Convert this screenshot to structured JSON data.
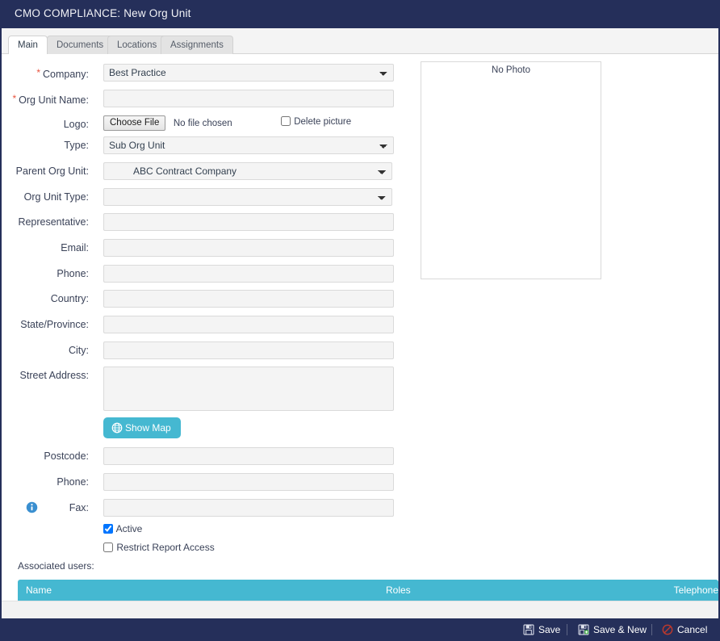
{
  "window": {
    "title_prefix": "CMO COMPLIANCE:",
    "title": "CMO COMPLIANCE: New Org Unit"
  },
  "colors": {
    "header_navy": "#252f5a",
    "accent_teal": "#45b8d1",
    "required_star": "#e8543f",
    "field_bg": "#f4f4f4"
  },
  "tabs": [
    {
      "label": "Main",
      "active": true
    },
    {
      "label": "Documents",
      "active": false
    },
    {
      "label": "Locations",
      "active": false
    },
    {
      "label": "Assignments",
      "active": false
    }
  ],
  "form": {
    "company": {
      "label": "Company:",
      "required": true,
      "value": "Best Practice"
    },
    "org_unit_name": {
      "label": "Org Unit Name:",
      "required": true,
      "value": ""
    },
    "logo": {
      "label": "Logo:",
      "button": "Choose File",
      "status": "No file chosen",
      "delete_picture_label": "Delete picture",
      "delete_picture_checked": false
    },
    "type": {
      "label": "Type:",
      "value": "Sub Org Unit"
    },
    "parent_org_unit": {
      "label": "Parent Org Unit:",
      "value": "ABC Contract Company"
    },
    "org_unit_type": {
      "label": "Org Unit Type:",
      "value": ""
    },
    "representative": {
      "label": "Representative:",
      "value": ""
    },
    "email": {
      "label": "Email:",
      "value": ""
    },
    "phone_top": {
      "label": "Phone:",
      "value": ""
    },
    "country": {
      "label": "Country:",
      "value": ""
    },
    "state_province": {
      "label": "State/Province:",
      "value": ""
    },
    "city": {
      "label": "City:",
      "value": ""
    },
    "street_address": {
      "label": "Street Address:",
      "value": ""
    },
    "show_map": {
      "label": "Show Map",
      "icon": "globe-icon"
    },
    "postcode": {
      "label": "Postcode:",
      "value": ""
    },
    "phone_bottom": {
      "label": "Phone:",
      "value": ""
    },
    "fax": {
      "label": "Fax:",
      "value": "",
      "icon": "info-icon"
    },
    "active": {
      "label": "Active",
      "checked": true
    },
    "restrict_report_access": {
      "label": "Restrict Report Access",
      "checked": false
    }
  },
  "photo": {
    "placeholder": "No Photo"
  },
  "associated_users": {
    "label": "Associated users:",
    "columns": [
      "Name",
      "Roles",
      "Telephone"
    ],
    "rows": []
  },
  "footer": {
    "save": {
      "label": "Save",
      "icon": "floppy-disk-icon"
    },
    "save_new": {
      "label": "Save & New",
      "icon": "floppy-disk-plus-icon"
    },
    "cancel": {
      "label": "Cancel",
      "icon": "prohibition-icon"
    }
  }
}
